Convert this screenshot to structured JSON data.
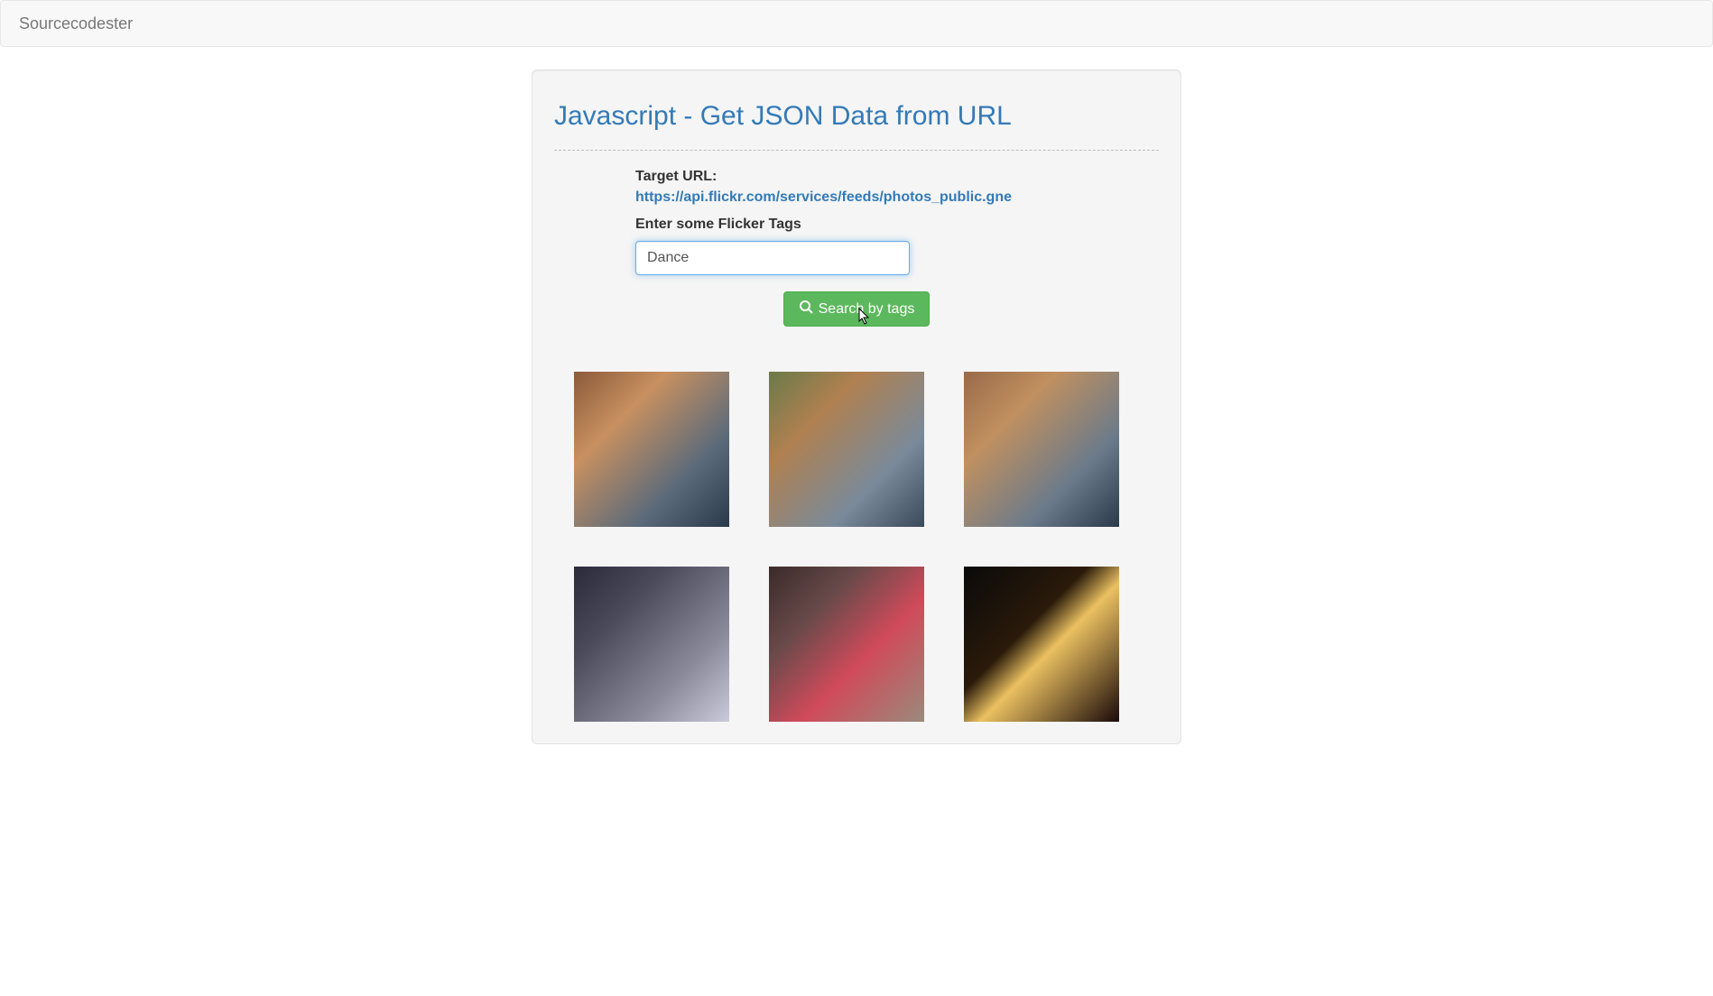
{
  "navbar": {
    "brand": "Sourcecodester"
  },
  "page": {
    "title": "Javascript - Get JSON Data from URL"
  },
  "form": {
    "target_label": "Target URL:",
    "target_url": "https://api.flickr.com/services/feeds/photos_public.gne",
    "tags_label": "Enter some Flicker Tags",
    "tags_value": "Dance",
    "search_button": "Search by tags",
    "search_icon": "search-icon"
  },
  "results": {
    "count": 6,
    "thumbnails": [
      {
        "alt": "dance-photo-1"
      },
      {
        "alt": "dance-photo-2"
      },
      {
        "alt": "dance-photo-3"
      },
      {
        "alt": "dance-photo-4"
      },
      {
        "alt": "dance-photo-5"
      },
      {
        "alt": "dance-photo-6"
      }
    ]
  },
  "colors": {
    "link": "#337ab7",
    "button_bg": "#5cb85c",
    "well_bg": "#f5f5f5",
    "navbar_bg": "#f8f8f8"
  }
}
